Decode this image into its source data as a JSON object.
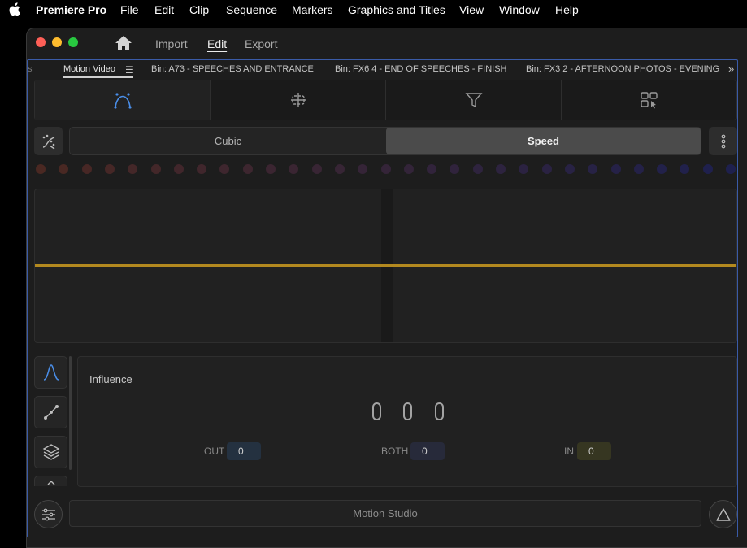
{
  "menubar": {
    "app_name": "Premiere Pro",
    "items": [
      "File",
      "Edit",
      "Clip",
      "Sequence",
      "Markers",
      "Graphics and Titles",
      "View",
      "Window",
      "Help"
    ]
  },
  "window": {
    "nav": {
      "import": "Import",
      "edit": "Edit",
      "export": "Export",
      "active": "Edit"
    }
  },
  "tabs": {
    "items": [
      "Motion Video",
      "Bin: A73 - SPEECHES AND ENTRANCE",
      "Bin: FX6 4 - END OF SPEECHES - FINISH",
      "Bin: FX3 2 - AFTERNOON PHOTOS - EVENING"
    ],
    "active": "Motion Video",
    "overflow_icon": "double-chevron-right-icon"
  },
  "toolbar": {
    "tools": [
      "bezier-curve-icon",
      "align-center-icon",
      "filter-icon",
      "grid-select-icon"
    ],
    "selected": "bezier-curve-icon"
  },
  "mode": {
    "options": [
      "Cubic",
      "Speed"
    ],
    "selected": "Speed"
  },
  "graph": {
    "curve_color": "#b3891f"
  },
  "influence": {
    "title": "Influence",
    "knob_values": [
      "0",
      "0",
      "0"
    ],
    "out_label": "OUT",
    "out_value": "0",
    "both_label": "BOTH",
    "both_value": "0",
    "in_label": "IN",
    "in_value": "0"
  },
  "footer": {
    "motion_studio_label": "Motion Studio"
  },
  "colors": {
    "accent_blue": "#4a8ee8",
    "out_box": "#243140",
    "both_box": "#272a3a",
    "in_box": "#363621"
  }
}
